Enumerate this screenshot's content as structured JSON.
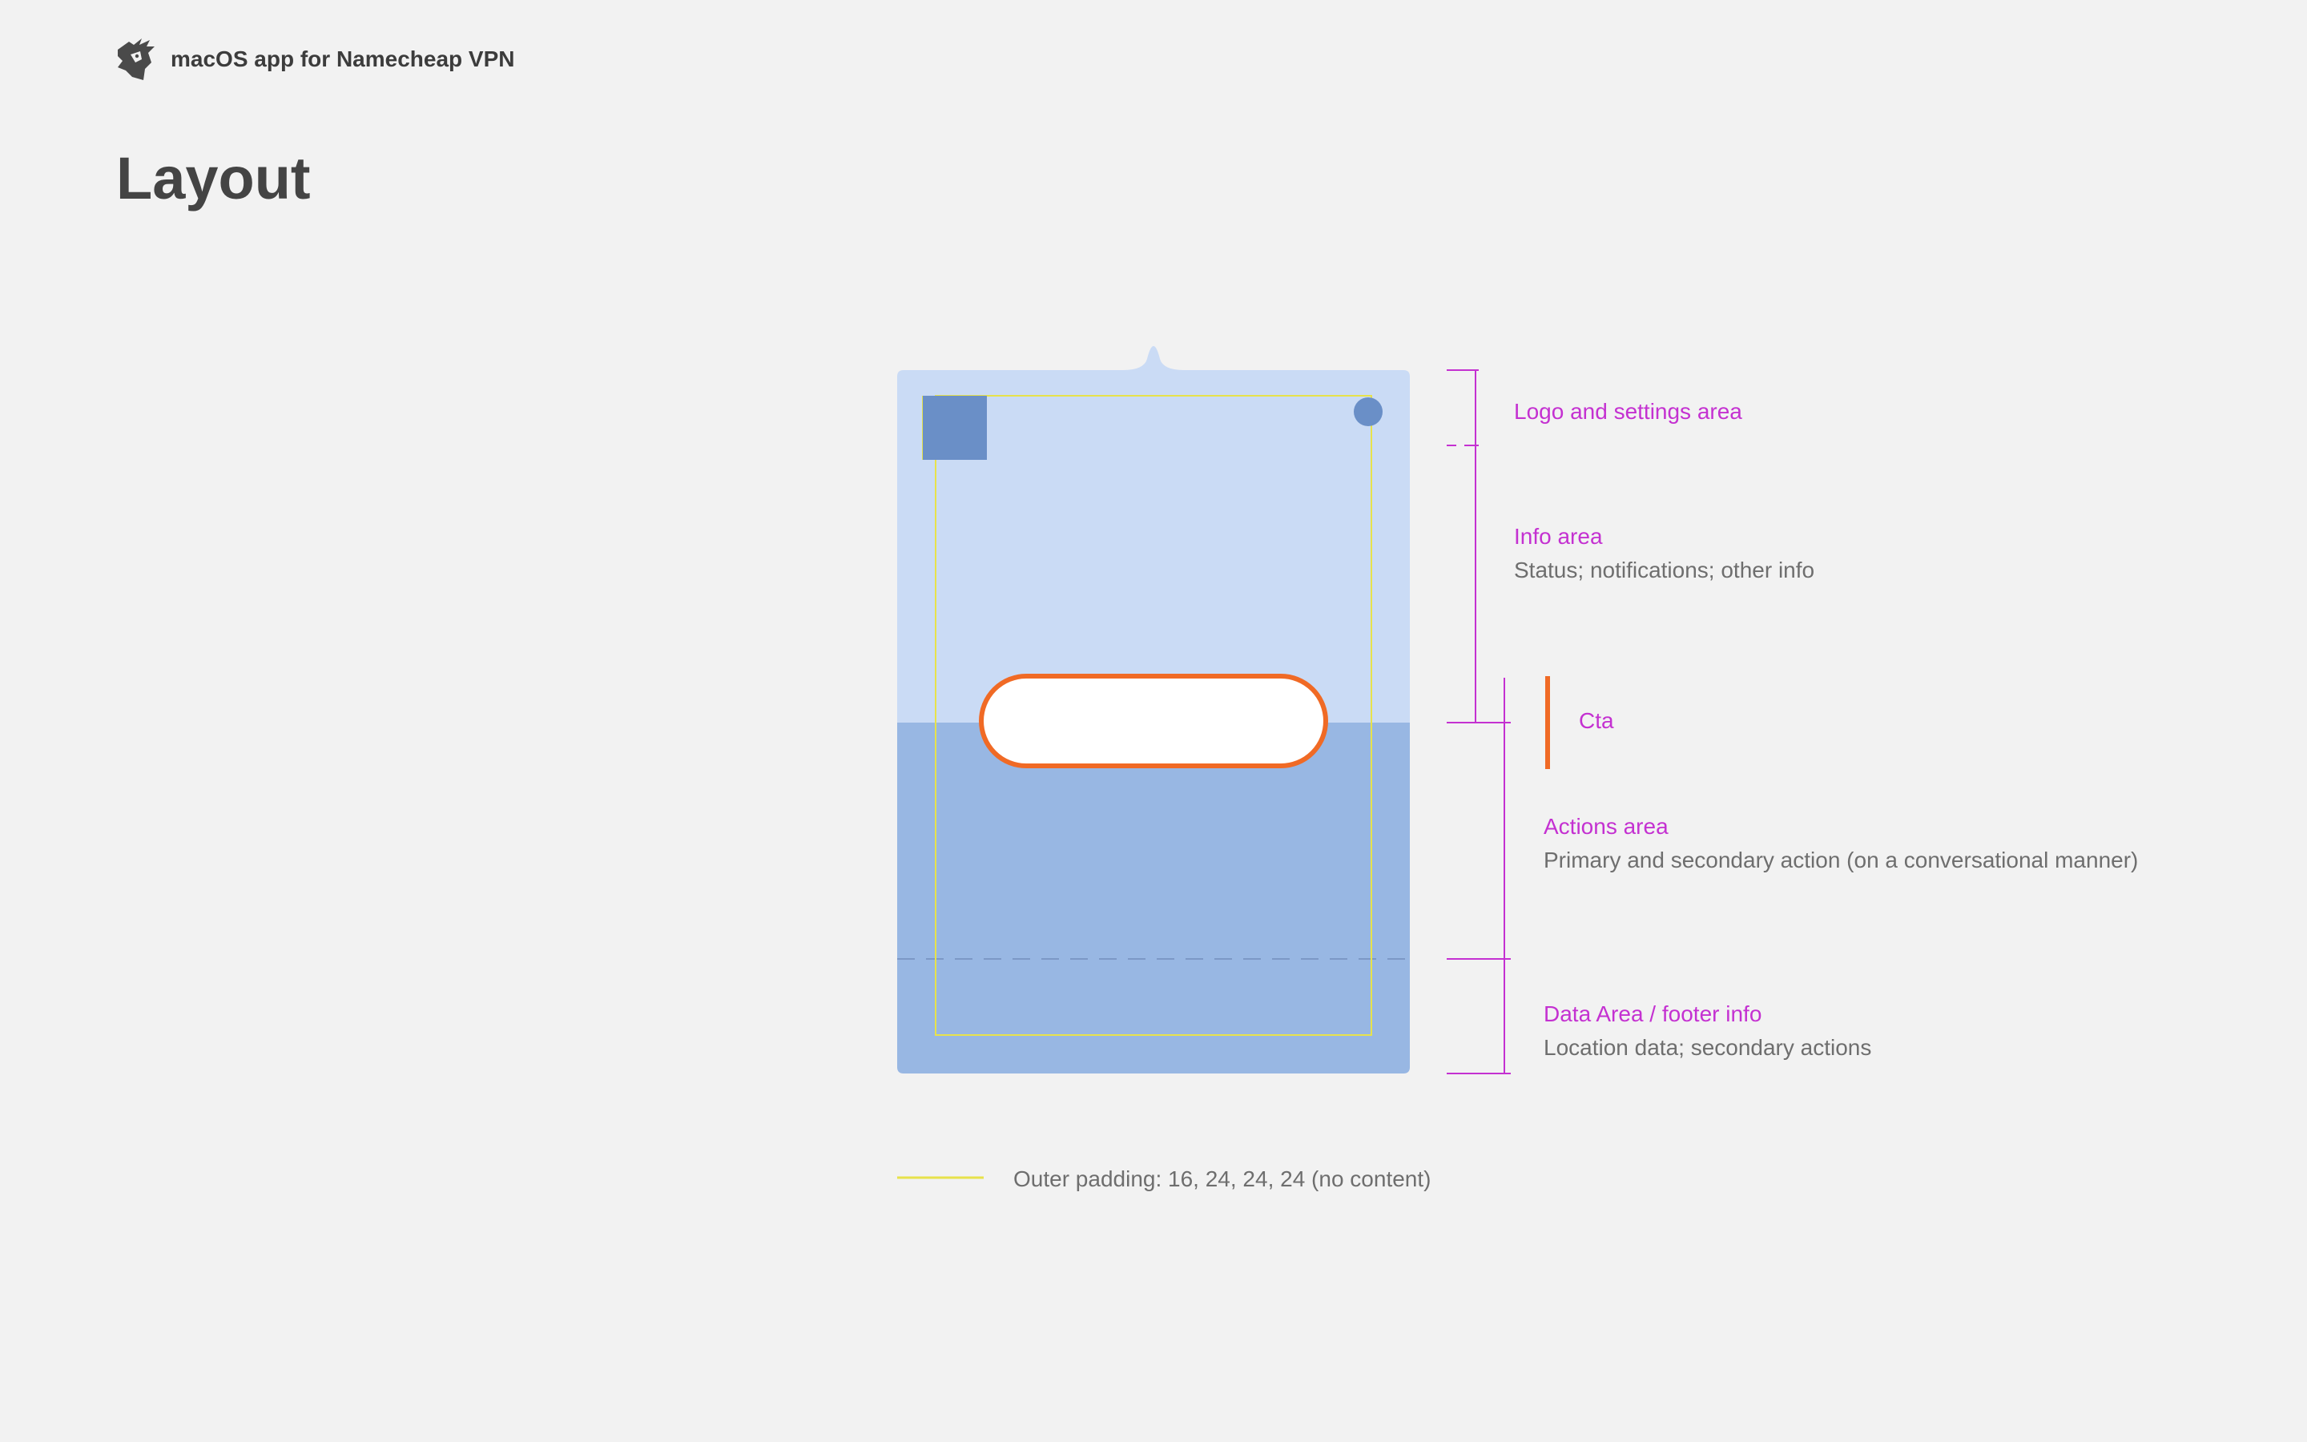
{
  "header": {
    "app_title": "macOS app for Namecheap VPN",
    "logo_icon": "namecheap-unicorn-icon"
  },
  "page_title": "Layout",
  "colors": {
    "background": "#f2f2f2",
    "top_area": "#cadbf5",
    "bottom_area": "#98b7e3",
    "placeholder": "#6a8fc7",
    "padding_guide": "#e7e24b",
    "annotation": "#c431d1",
    "cta_accent": "#f06a25"
  },
  "annotations": {
    "logo_settings": {
      "title": "Logo and settings area"
    },
    "info": {
      "title": "Info area",
      "desc": "Status; notifications; other info"
    },
    "cta": {
      "title": "Cta"
    },
    "actions": {
      "title": "Actions area",
      "desc": "Primary and secondary action (on a conversational manner)"
    },
    "data": {
      "title": "Data Area / footer info",
      "desc": "Location data; secondary actions"
    }
  },
  "legend": {
    "text": "Outer padding: 16, 24, 24, 24 (no content)"
  }
}
